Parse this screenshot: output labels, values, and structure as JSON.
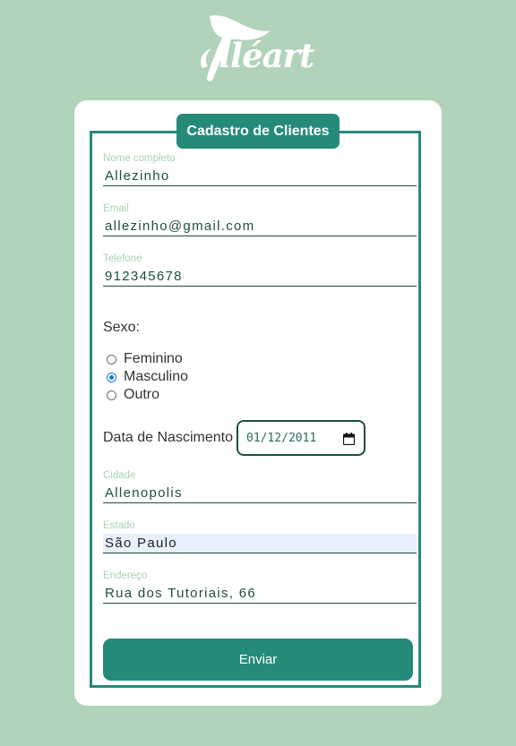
{
  "brand": {
    "logo_text": "lléart"
  },
  "form": {
    "legend": "Cadastro de Clientes",
    "nome": {
      "label": "Nome completo",
      "value": "Allezinho"
    },
    "email": {
      "label": "Email",
      "value": "allezinho@gmail.com"
    },
    "telefone": {
      "label": "Telefone",
      "value": "912345678"
    },
    "sexo": {
      "label": "Sexo:",
      "options": [
        "Feminino",
        "Masculino",
        "Outro"
      ],
      "selected": "Masculino"
    },
    "nascimento": {
      "label": "Data de Nascimento",
      "value": "01/12/2011"
    },
    "cidade": {
      "label": "Cidade",
      "value": "Allenopolis"
    },
    "estado": {
      "label": "Estado",
      "value": "São Paulo"
    },
    "endereco": {
      "label": "Endereço",
      "value": "Rua dos Tutoriais, 66"
    },
    "submit_label": "Enviar"
  },
  "colors": {
    "background": "#b0d3b9",
    "accent": "#268a79",
    "text_dark": "#1d4f40",
    "label_light": "#a8d2b4"
  },
  "icons": {
    "date_picker": "calendar-icon",
    "logo": "bird-logo-icon"
  }
}
